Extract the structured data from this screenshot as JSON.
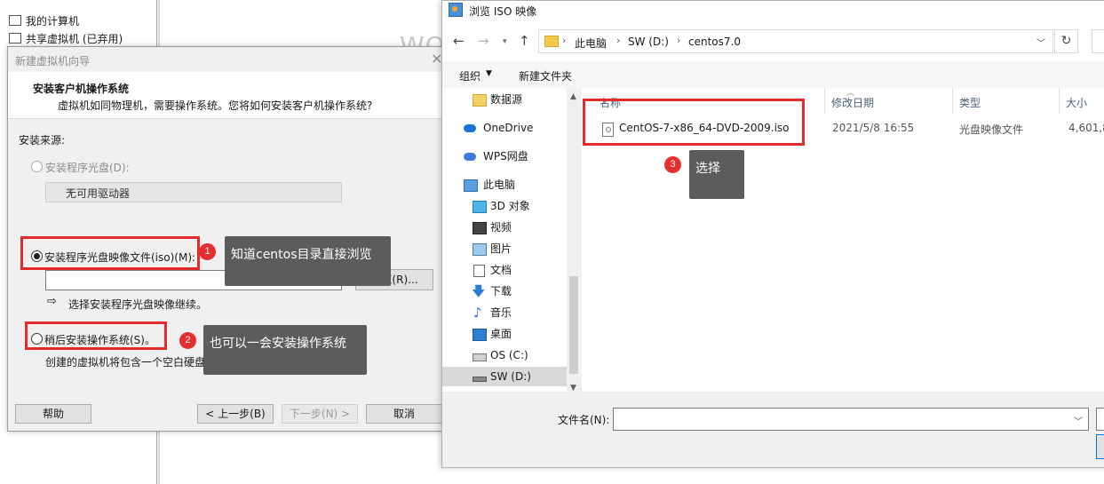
{
  "vmware": {
    "tree_items": [
      "我的计算机",
      "共享虚拟机 (已弃用)"
    ],
    "welcome_partial": "WO"
  },
  "wizard": {
    "title": "新建虚拟机向导",
    "close": "×",
    "heading": "安装客户机操作系统",
    "subheading": "虚拟机如同物理机，需要操作系统。您将如何安装客户机操作系统?",
    "source_label": "安装来源:",
    "opt_disc": "安装程序光盘(D):",
    "drive_value": "无可用驱动器",
    "opt_iso": "安装程序光盘映像文件(iso)(M):",
    "iso_value": "",
    "browse": "浏览(R)...",
    "iso_hint": "选择安装程序光盘映像继续。",
    "opt_later": "稍后安装操作系统(S)。",
    "later_hint": "创建的虚拟机将包含一个空白硬盘。",
    "buttons": {
      "help": "帮助",
      "back": "< 上一步(B)",
      "next": "下一步(N) >",
      "cancel": "取消"
    }
  },
  "browse_dialog": {
    "title": "浏览 ISO 映像",
    "breadcrumbs": [
      "此电脑",
      "SW (D:)",
      "centos7.0"
    ],
    "toolbar": {
      "organize": "组织",
      "new_folder": "新建文件夹"
    },
    "nav_items": [
      {
        "label": "数据源",
        "icon": "folder-icon"
      },
      {
        "label": "OneDrive",
        "icon": "cloud-icon"
      },
      {
        "label": "WPS网盘",
        "icon": "wps-cloud-icon"
      },
      {
        "label": "此电脑",
        "icon": "computer-icon"
      },
      {
        "label": "3D 对象",
        "icon": "cube-icon"
      },
      {
        "label": "视频",
        "icon": "video-icon"
      },
      {
        "label": "图片",
        "icon": "picture-icon"
      },
      {
        "label": "文档",
        "icon": "document-icon"
      },
      {
        "label": "下载",
        "icon": "download-icon"
      },
      {
        "label": "音乐",
        "icon": "music-icon"
      },
      {
        "label": "桌面",
        "icon": "desktop-icon"
      },
      {
        "label": "OS (C:)",
        "icon": "drive-icon"
      },
      {
        "label": "SW (D:)",
        "icon": "drive-icon",
        "selected": true
      }
    ],
    "columns": {
      "name": "名称",
      "modified": "修改日期",
      "type": "类型",
      "size": "大小"
    },
    "files": [
      {
        "name": "CentOS-7-x86_64-DVD-2009.iso",
        "modified": "2021/5/8 16:55",
        "type": "光盘映像文件",
        "size": "4,601,8"
      }
    ],
    "filename_label": "文件名(N):",
    "filename_value": ""
  },
  "annotations": [
    {
      "number": "1",
      "text": "知道centos目录直接浏览"
    },
    {
      "number": "2",
      "text": "也可以一会安装操作系统"
    },
    {
      "number": "3",
      "text": "选择"
    }
  ],
  "colors": {
    "annotation_red": "#e32b2b",
    "tooltip_bg": "#5c5c5c",
    "column_header": "#4c607a"
  }
}
